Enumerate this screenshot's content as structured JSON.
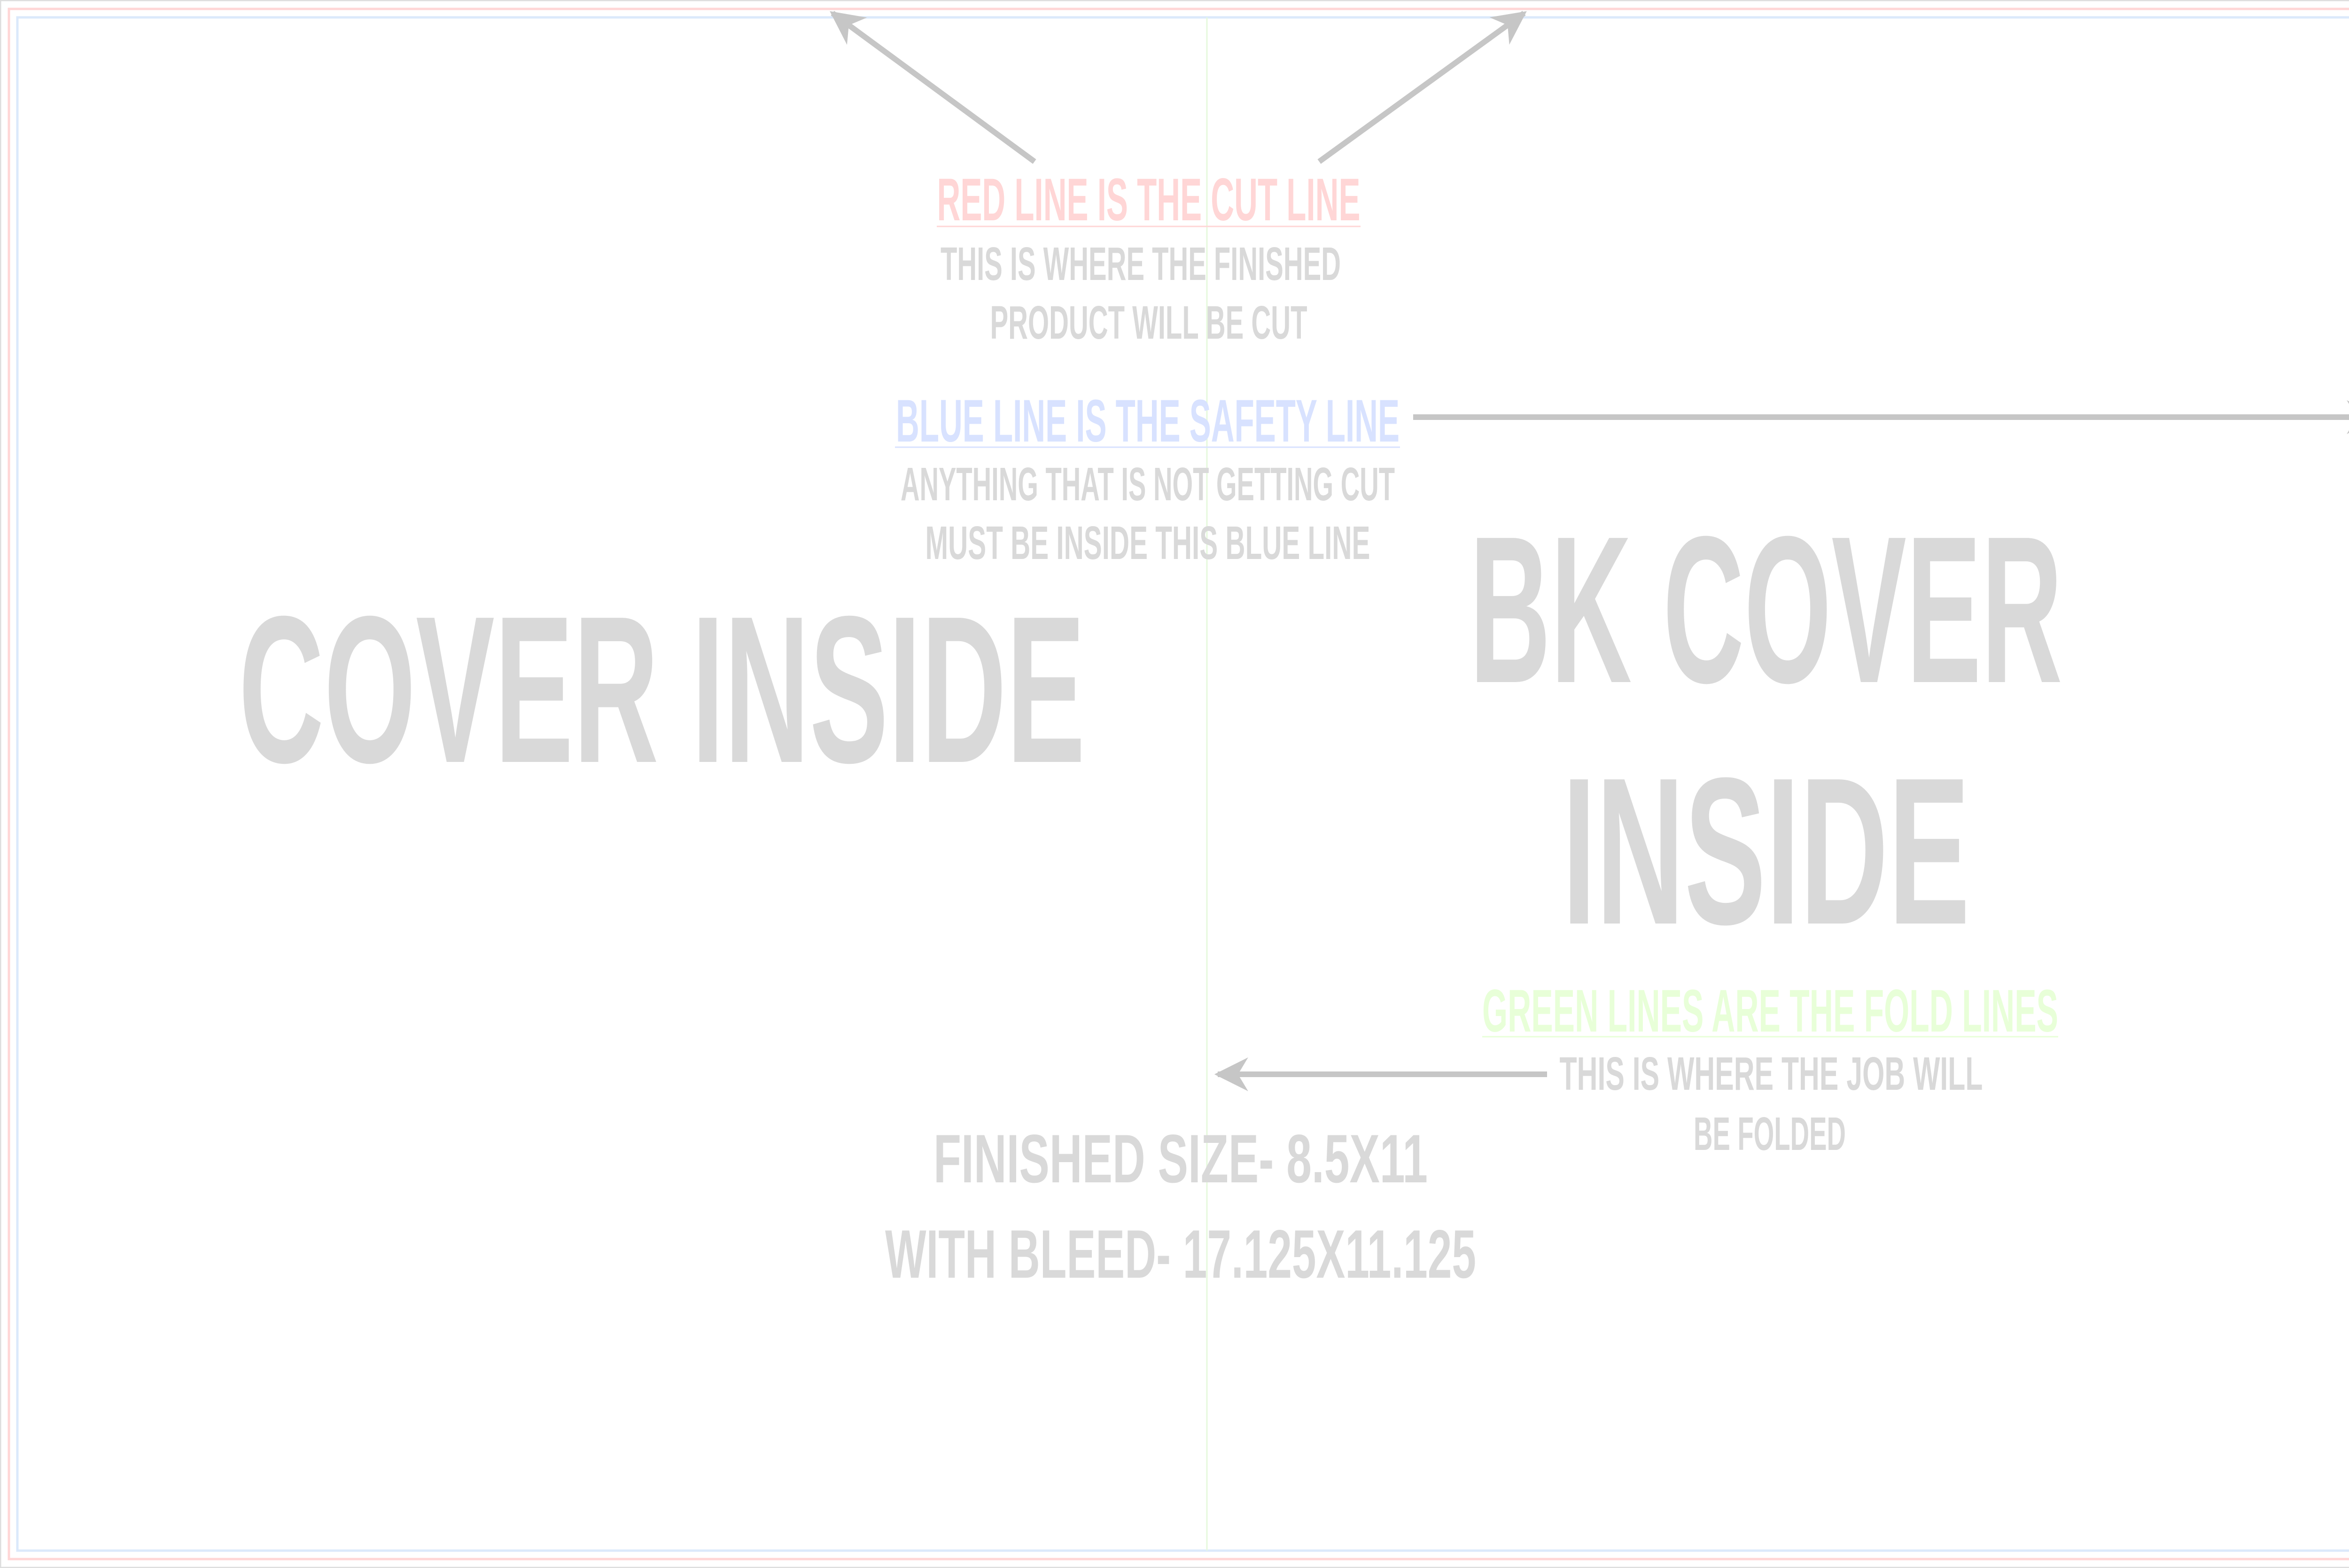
{
  "colors": {
    "cut_line": "#ffd6d6",
    "safety_line": "#dbe9fb",
    "fold_line": "#e6f9dc",
    "text_gray": "#d9d9d9",
    "arrow_gray": "#c6c6c6",
    "safety_text": "#d8e2ff",
    "fold_text": "#e8ffd8"
  },
  "cut_note": {
    "heading": "RED LINE IS THE CUT LINE",
    "line1": "THIS IS WHERE THE FINISHED",
    "line2": "PRODUCT WILL BE CUT"
  },
  "safety_note": {
    "heading": "BLUE LINE IS THE SAFETY LINE",
    "line1": "ANYTHING THAT IS NOT GETTING CUT",
    "line2": "MUST BE INSIDE THIS BLUE LINE"
  },
  "fold_note": {
    "heading": "GREEN LINES ARE THE FOLD LINES",
    "line1": "THIS IS WHERE THE JOB WILL",
    "line2": "BE FOLDED"
  },
  "panels": {
    "left": "COVER INSIDE",
    "right_line1": "BK COVER",
    "right_line2": "INSIDE"
  },
  "sizes": {
    "finished": "FINISHED SIZE- 8.5X11",
    "bleed": "WITH BLEED- 17.125X11.125"
  }
}
